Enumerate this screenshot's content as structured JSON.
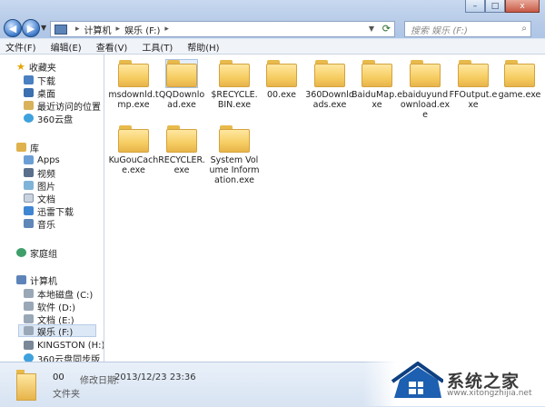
{
  "window": {
    "breadcrumb": [
      "计算机",
      "娱乐 (F:)"
    ],
    "search_placeholder": "搜索 娱乐 (F:)",
    "controls": {
      "minimize": "–",
      "maximize": "□",
      "close": "x"
    }
  },
  "menu": [
    "文件(F)",
    "编辑(E)",
    "查看(V)",
    "工具(T)",
    "帮助(H)"
  ],
  "nav": {
    "favorites": {
      "label": "收藏夹",
      "items": [
        "下载",
        "桌面",
        "最近访问的位置",
        "360云盘"
      ]
    },
    "libraries": {
      "label": "库",
      "items": [
        "Apps",
        "视频",
        "图片",
        "文档",
        "迅雷下载",
        "音乐"
      ]
    },
    "homegroup": "家庭组",
    "computer": {
      "label": "计算机",
      "items": [
        "本地磁盘 (C:)",
        "软件 (D:)",
        "文档 (E:)",
        "娱乐 (F:)",
        "KINGSTON (H:)",
        "360云盘同步版"
      ]
    }
  },
  "items": [
    "msdownld.tmp.exe",
    "QQDownload.exe",
    "$RECYCLE.BIN.exe",
    "00.exe",
    "360Downloads.exe",
    "BaiduMap.exe",
    "baiduyundownload.exe",
    "FFOutput.exe",
    "game.exe",
    "KuGouCache.exe",
    "RECYCLER.exe",
    "System Volume Information.exe"
  ],
  "status": {
    "name": "00",
    "modified_label": "修改日期:",
    "modified_value": "2013/12/23 23:36",
    "type": "文件夹"
  },
  "watermark": {
    "text": "系统之家",
    "url": "www.xitongzhijia.net"
  },
  "colors": {
    "folder": "#f6cd62",
    "selection": "#dde8f6",
    "accent": "#3a78c9"
  }
}
